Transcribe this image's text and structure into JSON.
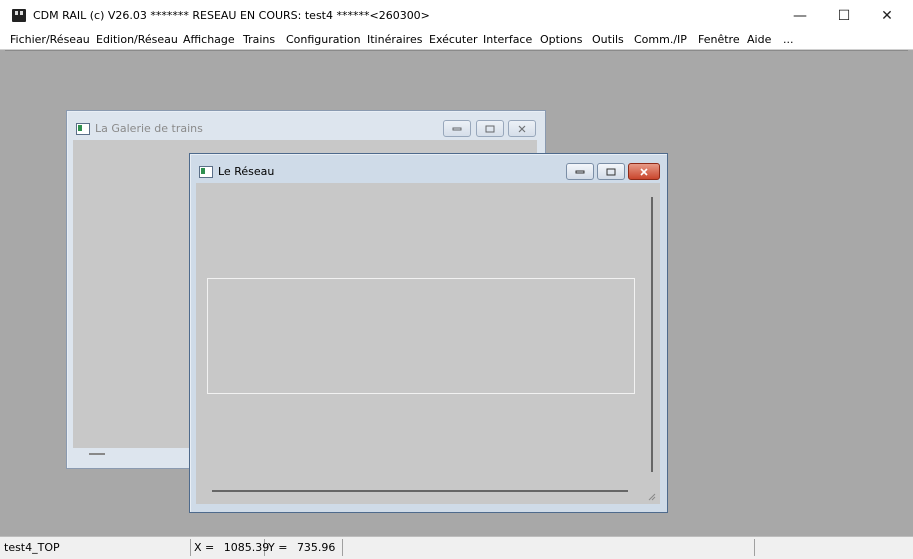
{
  "app": {
    "title": "CDM RAIL (c) V26.03     ******* RESEAU EN COURS: test4 ******<260300>",
    "minimize": "—",
    "maximize": "☐",
    "close": "✕"
  },
  "menu": {
    "items": [
      "Fichier/Réseau",
      "Edition/Réseau",
      "Affichage",
      "Trains",
      "Configuration",
      "Itinéraires",
      "Exécuter",
      "Interface",
      "Options",
      "Outils",
      "Comm./IP",
      "Fenêtre",
      "Aide",
      "..."
    ]
  },
  "windows": {
    "galerie": {
      "title": "La Galerie de trains"
    },
    "reseau": {
      "title": "Le Réseau"
    }
  },
  "status": {
    "layer": "test4_TOP",
    "x_label": "X =",
    "x_value": "1085.39",
    "y_label": "Y =",
    "y_value": "735.96"
  }
}
